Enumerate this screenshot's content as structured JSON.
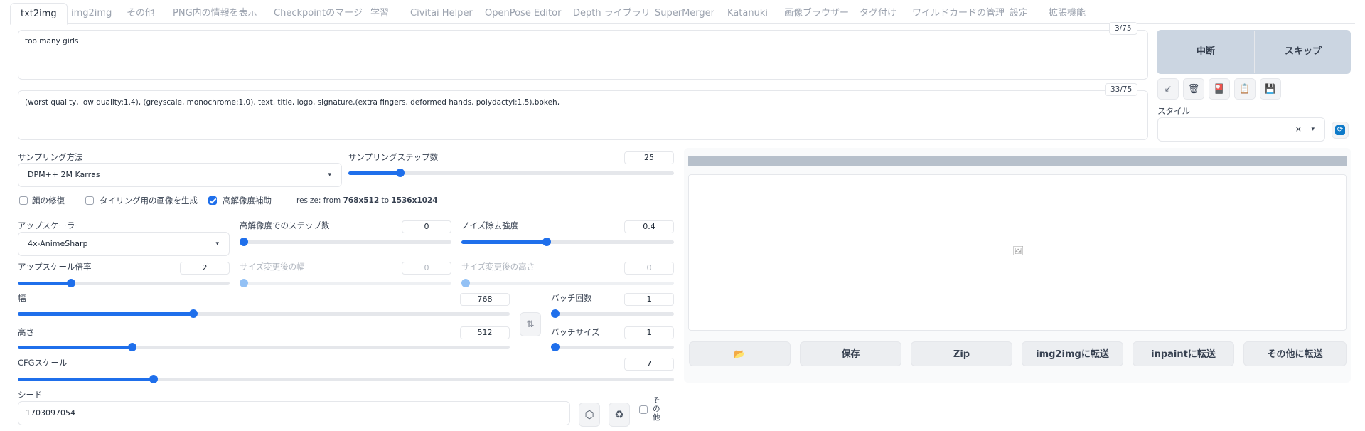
{
  "tabs": [
    "txt2img",
    "img2img",
    "その他",
    "PNG内の情報を表示",
    "Checkpointのマージ",
    "学習",
    "Civitai Helper",
    "OpenPose Editor",
    "Depth ライブラリ",
    "SuperMerger",
    "Katanuki",
    "画像ブラウザー",
    "タグ付け",
    "ワイルドカードの管理",
    "設定",
    "拡張機能"
  ],
  "prompt": {
    "text": "too many girls",
    "tokens": "3/75"
  },
  "negative_prompt": {
    "text": "(worst quality, low quality:1.4), (greyscale, monochrome:1.0), text, title, logo, signature,(extra fingers, deformed hands, polydactyl:1.5),bokeh,",
    "tokens": "33/75"
  },
  "generate": {
    "interrupt": "中断",
    "skip": "スキップ"
  },
  "style": {
    "label": "スタイル",
    "clear": "×",
    "caret": "▾"
  },
  "tool_icons": [
    "↙",
    "🗑",
    "🎴",
    "📋",
    "💾"
  ],
  "sampling": {
    "method_label": "サンプリング方法",
    "method_value": "DPM++ 2M Karras",
    "steps_label": "サンプリングステップ数",
    "steps_value": "25",
    "steps_fraction": 0.16
  },
  "options": {
    "face_restore": "顔の修復",
    "tiling": "タイリング用の画像を生成",
    "hires_fix": "高解像度補助",
    "resize_prefix": "resize: from ",
    "resize_from": "768x512",
    "resize_to_word": " to ",
    "resize_to": "1536x1024"
  },
  "hires": {
    "upscaler_label": "アップスケーラー",
    "upscaler_value": "4x-AnimeSharp",
    "steps_label": "高解像度でのステップ数",
    "steps_value": "0",
    "steps_fraction": 0.0,
    "denoise_label": "ノイズ除去強度",
    "denoise_value": "0.4",
    "denoise_fraction": 0.4,
    "scale_label": "アップスケール倍率",
    "scale_value": "2",
    "scale_fraction": 0.25,
    "resize_w_label": "サイズ変更後の幅",
    "resize_w_value": "0",
    "resize_h_label": "サイズ変更後の高さ",
    "resize_h_value": "0"
  },
  "size": {
    "width_label": "幅",
    "width_value": "768",
    "width_fraction": 0.357,
    "height_label": "高さ",
    "height_value": "512",
    "height_fraction": 0.232,
    "swap_icon": "⇅"
  },
  "batch": {
    "count_label": "バッチ回数",
    "count_value": "1",
    "count_fraction": 0.0,
    "size_label": "バッチサイズ",
    "size_value": "1",
    "size_fraction": 0.0
  },
  "cfg": {
    "label": "CFGスケール",
    "value": "7",
    "fraction": 0.207
  },
  "seed": {
    "label": "シード",
    "value": "1703097054",
    "dice_icon": "⬡",
    "recycle_icon": "♻",
    "extra_label": "その他"
  },
  "output": {
    "image_icon": "🖼",
    "buttons": [
      "📂",
      "保存",
      "Zip",
      "img2imgに転送",
      "inpaintに転送",
      "その他に転送"
    ]
  },
  "colors": {
    "accent": "#1f6feb",
    "progress": "#b7c0cb",
    "generate_bg": "#cbd5e1"
  }
}
